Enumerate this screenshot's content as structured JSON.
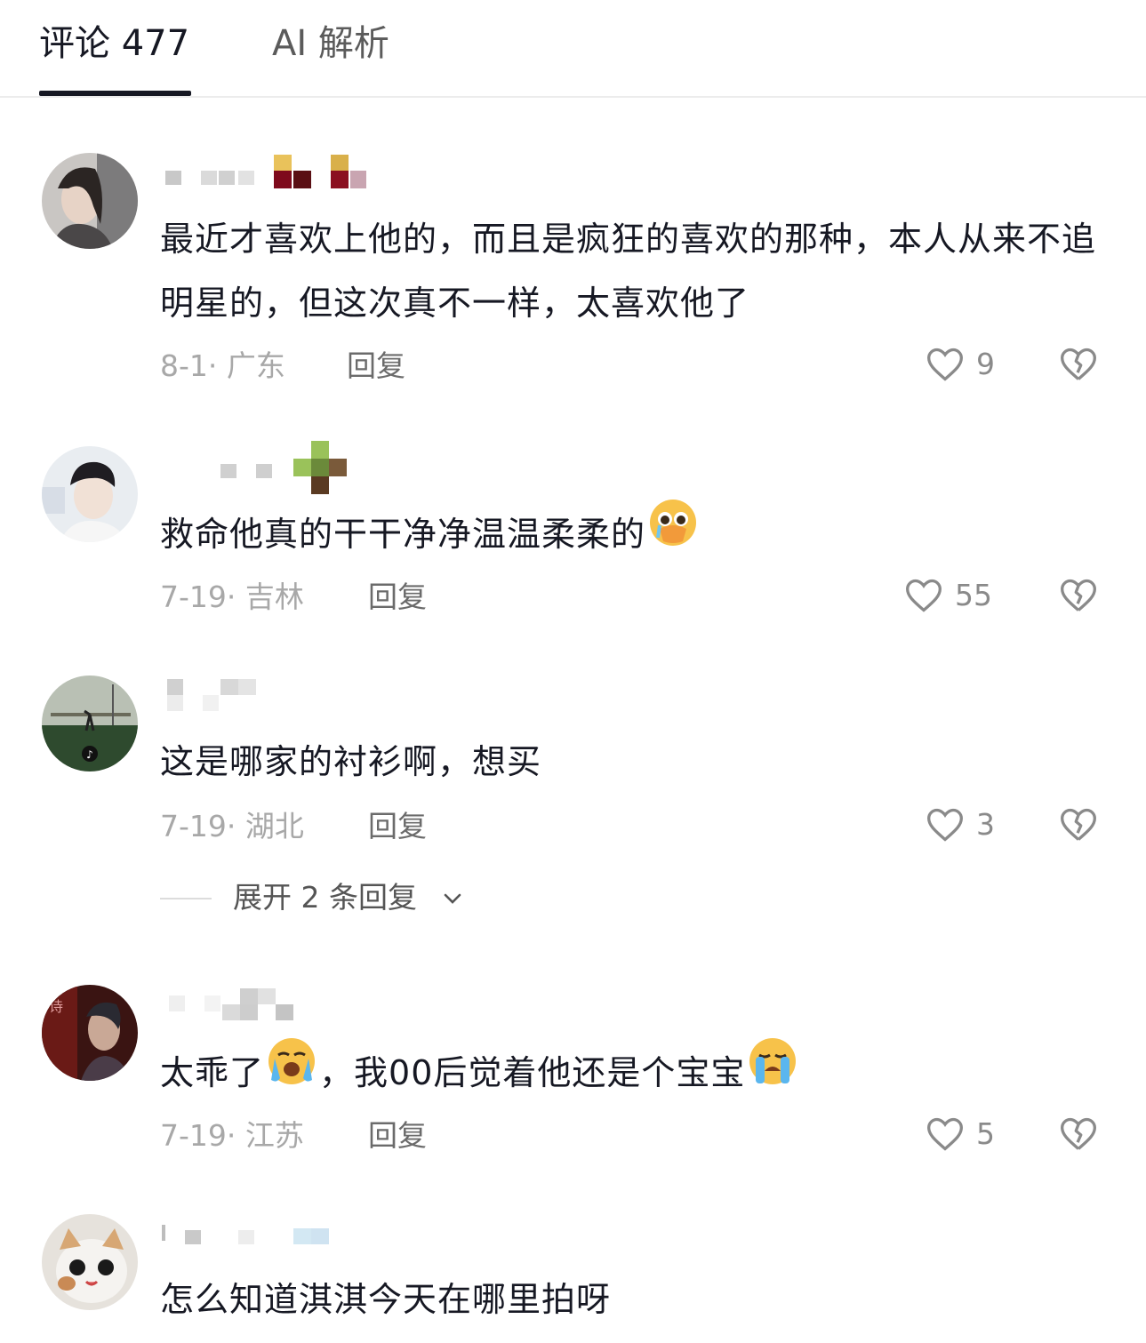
{
  "tabs": {
    "comments": "评论 477",
    "ai": "AI 解析"
  },
  "comments": [
    {
      "text": "最近才喜欢上他的，而且是疯狂的喜欢的那种，本人从来不追明星的，但这次真不一样，太喜欢他了",
      "date_loc": "8-1· 广东",
      "reply": "回复",
      "likes": "9"
    },
    {
      "text": "救命他真的干干净净温温柔柔的",
      "emoji_after": "pleading-face-emoji",
      "date_loc": "7-19· 吉林",
      "reply": "回复",
      "likes": "55"
    },
    {
      "text": "这是哪家的衬衫啊，想买",
      "date_loc": "7-19· 湖北",
      "reply": "回复",
      "likes": "3",
      "expand": "展开 2 条回复"
    },
    {
      "text_a": "太乖了",
      "text_b": "，我00后觉着他还是个宝宝",
      "date_loc": "7-19· 江苏",
      "reply": "回复",
      "likes": "5"
    },
    {
      "text": "怎么知道淇淇今天在哪里拍呀"
    }
  ],
  "icons": {
    "like": "heart-icon",
    "dislike": "broken-heart-icon",
    "expand": "chevron-down-icon"
  }
}
